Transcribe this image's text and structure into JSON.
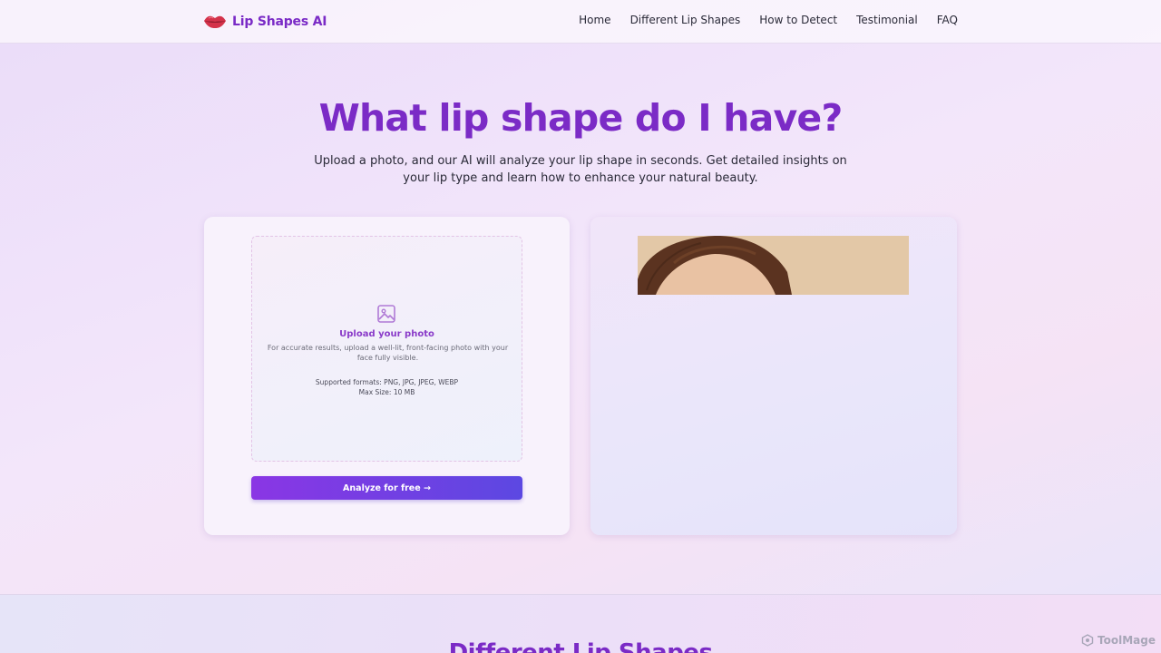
{
  "header": {
    "logo_text": "Lip Shapes AI",
    "logo_icon": "lips-icon",
    "nav": [
      "Home",
      "Different Lip Shapes",
      "How to Detect",
      "Testimonial",
      "FAQ"
    ]
  },
  "hero": {
    "title": "What lip shape do I have?",
    "subtitle": "Upload a photo, and our AI will analyze your lip shape in seconds. Get detailed insights on your lip type and learn how to enhance your natural beauty."
  },
  "upload": {
    "icon": "image-icon",
    "title": "Upload your photo",
    "description": "For accurate results, upload a well-lit, front-facing photo with your face fully visible.",
    "formats": "Supported formats: PNG, JPG, JPEG, WEBP",
    "max_size": "Max Size: 10 MB",
    "button_label": "Analyze for free →"
  },
  "sections": {
    "next_title": "Different Lip Shapes"
  },
  "watermark": "ToolMage",
  "colors": {
    "brand": "#7b2bc6",
    "button_start": "#8a36e4",
    "button_end": "#5c48e2"
  }
}
